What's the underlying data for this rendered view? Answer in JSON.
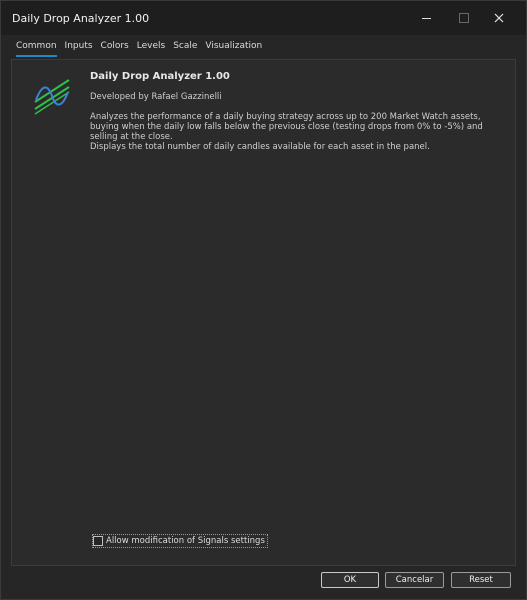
{
  "window": {
    "title": "Daily Drop Analyzer 1.00"
  },
  "tabs": [
    {
      "label": "Common",
      "active": true
    },
    {
      "label": "Inputs"
    },
    {
      "label": "Colors"
    },
    {
      "label": "Levels"
    },
    {
      "label": "Scale"
    },
    {
      "label": "Visualization"
    }
  ],
  "info": {
    "title": "Daily Drop Analyzer 1.00",
    "developer": "Developed by Rafael Gazzinelli",
    "description_1": "Analyzes the performance of a daily buying strategy across up to 200 Market Watch assets, buying when the daily low falls below the previous close (testing drops from 0% to -5%) and selling at the close.",
    "description_2": "Displays the total number of daily candles available for each asset in the panel."
  },
  "signals": {
    "label": "Allow modification of Signals settings",
    "checked": false
  },
  "buttons": {
    "ok": "OK",
    "cancel": "Cancelar",
    "reset": "Reset"
  },
  "icons": {
    "logo": "indicator-logo-icon",
    "minimize": "minimize-icon",
    "maximize": "maximize-icon",
    "close": "close-icon"
  },
  "colors": {
    "accent": "#1e88c8",
    "logo_green": "#2fbf4a",
    "logo_blue": "#3b82d6"
  }
}
